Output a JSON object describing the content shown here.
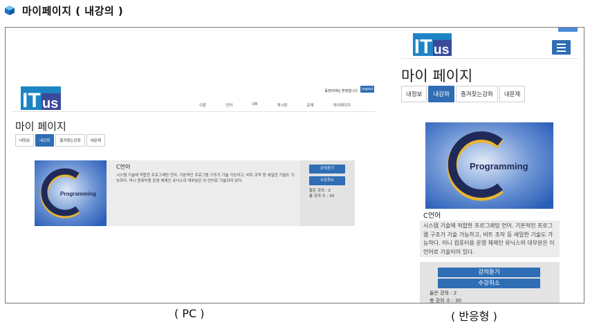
{
  "doc": {
    "title": "마이페이지 ( 내강의 )",
    "icon": "blue-cube-icon"
  },
  "brand": {
    "logo_text_i": "IT",
    "logo_text_us": "us"
  },
  "pc": {
    "greeting": "동방미래님 환영합니다",
    "logout": "Logout",
    "nav": [
      "이론",
      "언어",
      "DB",
      "게시판",
      "문제",
      "마이페이지"
    ],
    "page_title": "마이 페이지",
    "tabs": [
      "내정보",
      "내강좌",
      "즐겨찾는강좌",
      "내문제"
    ],
    "active_tab": "내강좌",
    "course": {
      "name": "C언어",
      "description": "시스템 기술에 적합한 프로그래밍 언어. 기본적인 프로그램 구조가 기술 가능하고, 비트 조작 등 세밀한 기술도 가능하다. 미니 컴퓨터용 운영 체제인 유닉스의 대부분은 이 언어로 기술되어 있다.",
      "btn_listen": "강의듣기",
      "btn_cancel": "수강취소",
      "heard": "들은 강의 : 2",
      "total": "총 강의 수 : 30"
    },
    "caption": "( PC )"
  },
  "mobile": {
    "page_title": "마이 페이지",
    "tabs": [
      "내정보",
      "내강좌",
      "즐겨찾는강좌",
      "내문제"
    ],
    "course": {
      "name": "C언어",
      "description": "시스템 기술에 적합한 프로그래밍 언어. 기본적인 프로그램 구조가 기술 가능하고, 비트 조작 등 세밀한 기술도 가능하다. 미니 컴퓨터용 운영 체제인 유닉스의 대부분은 이 언어로 기술되어 있다.",
      "btn_listen": "강의듣기",
      "btn_cancel": "수강취소",
      "heard": "들은 강의 : 2",
      "total": "총 강의 수 : 30"
    },
    "caption": "( 반응형 )"
  },
  "thumb_text": "Programming",
  "colors": {
    "accent": "#2f6db5",
    "logo_bg": "#1d84c6",
    "logo_us_bg": "#3a4a9a",
    "thumb_bg": "#2a5fb8",
    "thumb_c_ring": "#e8b531"
  }
}
